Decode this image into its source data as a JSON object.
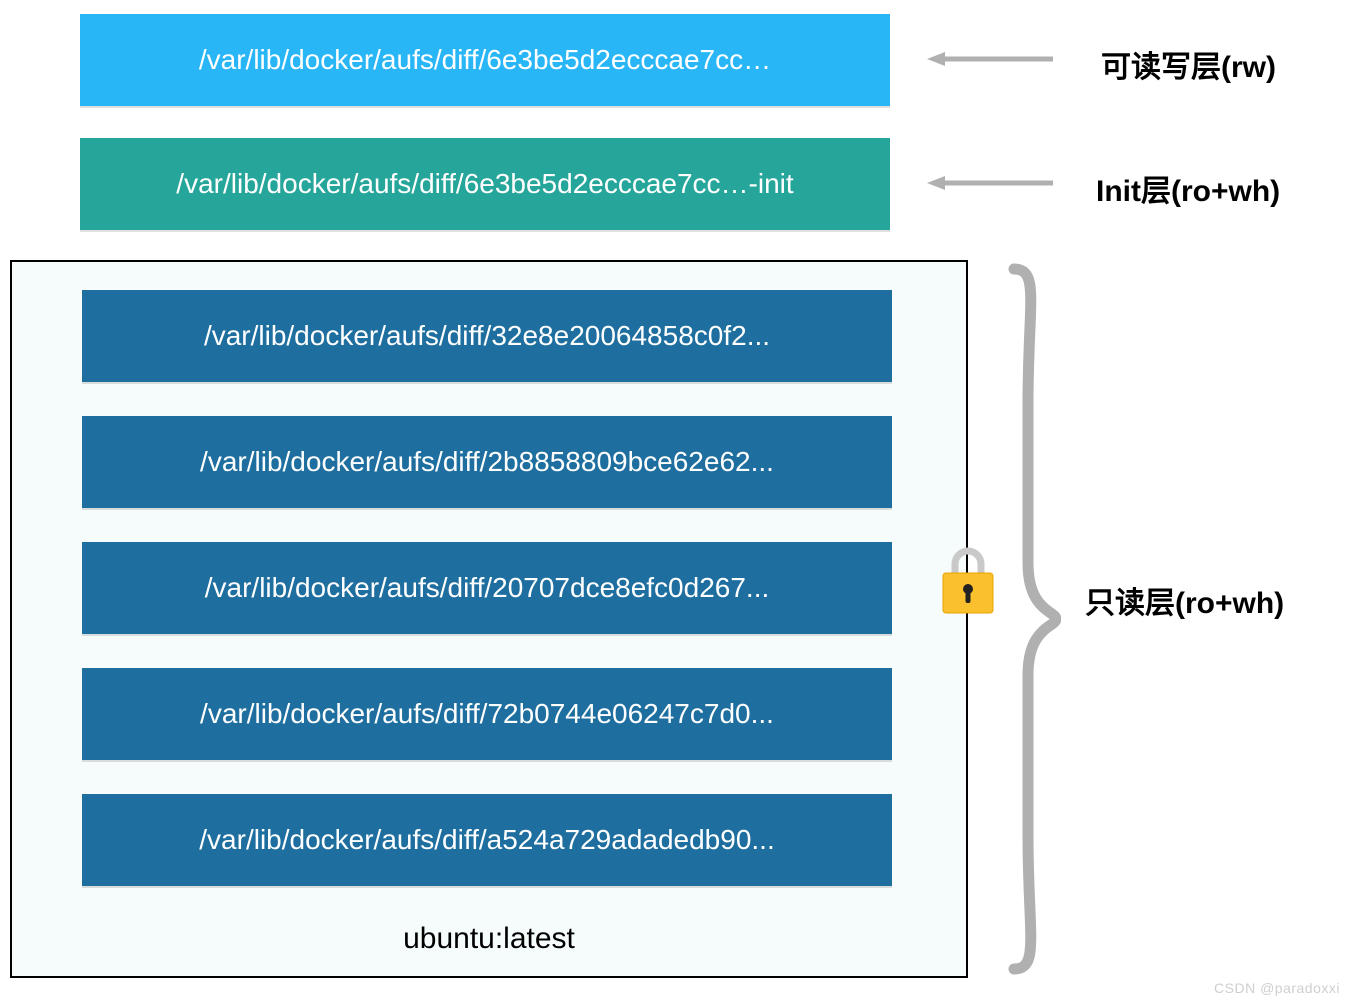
{
  "layers": {
    "rw": {
      "text": "/var/lib/docker/aufs/diff/6e3be5d2ecccae7cc…",
      "label": "可读写层(rw)"
    },
    "init": {
      "text": "/var/lib/docker/aufs/diff/6e3be5d2ecccae7cc…-init",
      "label": "Init层(ro+wh)"
    },
    "ro": {
      "label": "只读层(ro+wh)",
      "items": [
        "/var/lib/docker/aufs/diff/32e8e20064858c0f2...",
        "/var/lib/docker/aufs/diff/2b8858809bce62e62...",
        "/var/lib/docker/aufs/diff/20707dce8efc0d267...",
        "/var/lib/docker/aufs/diff/72b0744e06247c7d0...",
        "/var/lib/docker/aufs/diff/a524a729adadedb90..."
      ],
      "caption": "ubuntu:latest"
    }
  },
  "colors": {
    "rw": "#29b6f6",
    "init": "#26a69a",
    "ro": "#1e6f9f",
    "arrow": "#b0b0b0",
    "brace": "#b0b0b0"
  },
  "watermark": "CSDN @paradoxxi"
}
